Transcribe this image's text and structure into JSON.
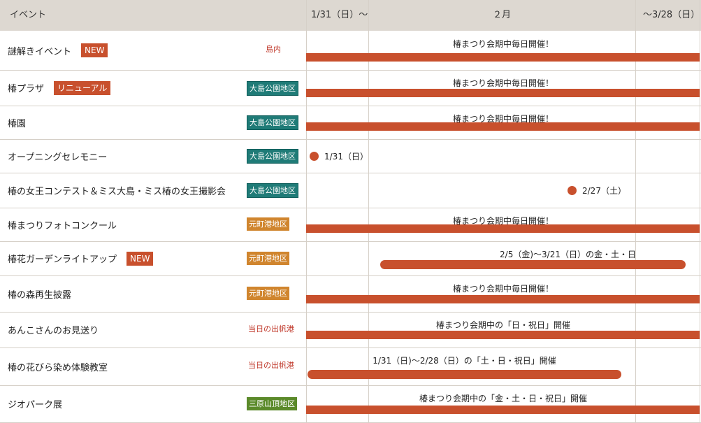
{
  "header": {
    "event_col": "イベント",
    "col_start": "1/31（日）〜",
    "col_feb": "２月",
    "col_end": "〜3/28（日）"
  },
  "rows": [
    {
      "name": "謎解きイベント",
      "badge": "NEW",
      "badge_color": "#c8502d",
      "area": "島内",
      "area_style": "red-text",
      "bar_label": "椿まつり会期中毎日開催！"
    },
    {
      "name": "椿プラザ",
      "badge": "リニューアル",
      "badge_color": "#c8502d",
      "area": "大島公園地区",
      "area_style": "teal",
      "bar_label": "椿まつり会期中毎日開催！"
    },
    {
      "name": "椿園",
      "area": "大島公園地区",
      "area_style": "teal",
      "bar_label": "椿まつり会期中毎日開催！"
    },
    {
      "name": "オープニングセレモニー",
      "area": "大島公園地区",
      "area_style": "teal",
      "dot_label": "1/31（日）"
    },
    {
      "name": "椿の女王コンテスト＆ミス大島・ミス椿の女王撮影会",
      "area": "大島公園地区",
      "area_style": "teal",
      "dot_label": "2/27（土）"
    },
    {
      "name": "椿まつりフォトコンクール",
      "area": "元町港地区",
      "area_style": "orange",
      "bar_label": "椿まつり会期中毎日開催！"
    },
    {
      "name": "椿花ガーデンライトアップ",
      "badge": "NEW",
      "badge_color": "#c8502d",
      "area": "元町港地区",
      "area_style": "orange",
      "bar_label": "2/5（金)〜3/21（日）の金・土・日"
    },
    {
      "name": "椿の森再生披露",
      "area": "元町港地区",
      "area_style": "orange",
      "bar_label": "椿まつり会期中毎日開催！"
    },
    {
      "name": "あんこさんのお見送り",
      "area": "当日の出帆港",
      "area_style": "red-text",
      "bar_label": "椿まつり会期中の「日・祝日」開催"
    },
    {
      "name": "椿の花びら染め体験教室",
      "area": "当日の出帆港",
      "area_style": "red-text",
      "bar_label": "1/31（日)〜2/28（日）の「土・日・祝日」開催"
    },
    {
      "name": "ジオパーク展",
      "area": "三原山頂地区",
      "area_style": "green",
      "bar_label": "椿まつり会期中の「金・土・日・祝日」開催"
    }
  ],
  "colors": {
    "accent": "#c8502d",
    "teal": "#1f7b77",
    "orange": "#d0852e",
    "green": "#5b8a2a",
    "header_bg": "#ddd8d1"
  }
}
